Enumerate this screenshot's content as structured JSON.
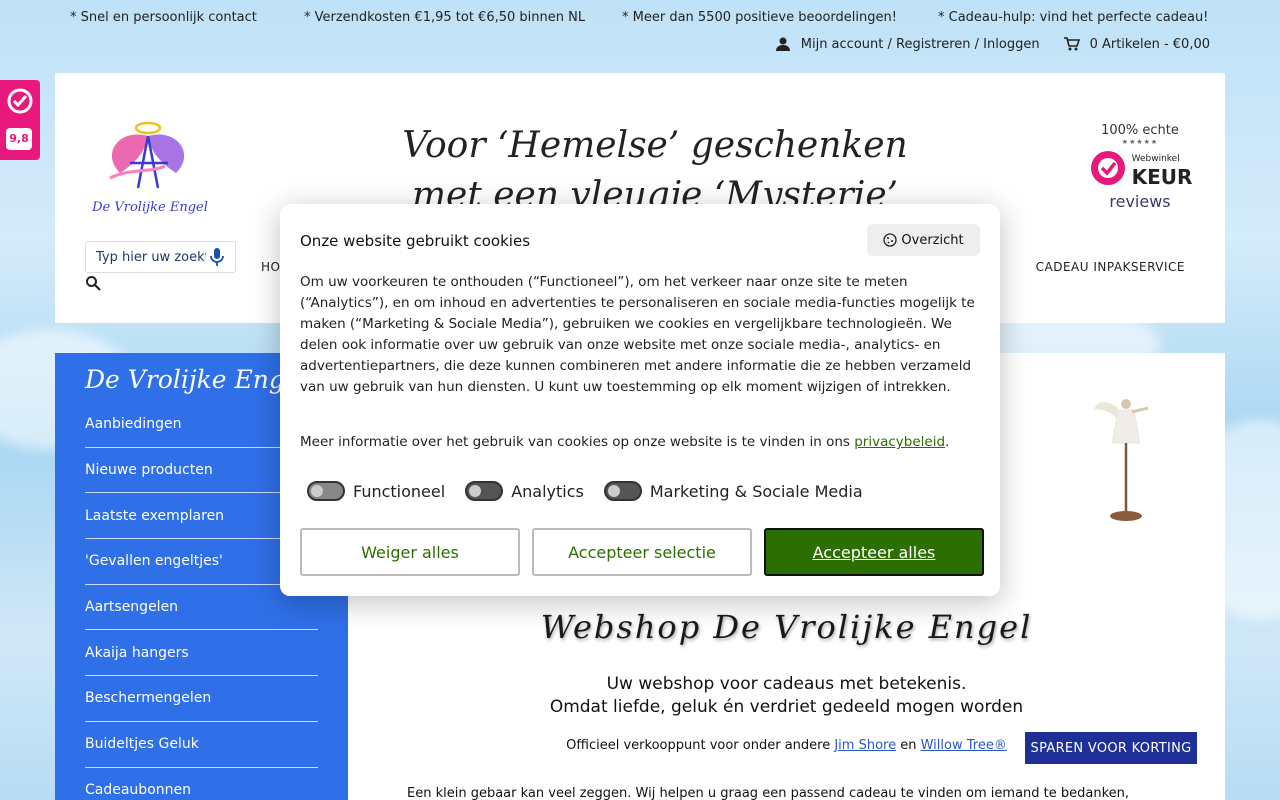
{
  "usp": [
    "* Snel en persoonlijk contact",
    "* Verzendkosten €1,95 tot €6,50 binnen NL",
    "* Meer dan 5500 positieve beoordelingen!",
    "* Cadeau-hulp: vind het perfecte cadeau!"
  ],
  "account": {
    "links": "Mijn account / Registreren / Inloggen",
    "cart": "0 Artikelen - €0,00"
  },
  "header": {
    "tagline_line1": "Voor ‘Hemelse’ geschenken",
    "tagline_line2": "met een vleugje ‘Mysterie’",
    "logo_text": "De Vrolijke Engel",
    "search_placeholder": "Typ hier uw zoekterm",
    "nav_home": "HO",
    "nav_wrap": "CADEAU INPAKSERVICE",
    "keur": {
      "echte": "100% echte",
      "stars": "★★★★★",
      "webwinkel": "Webwinkel",
      "keur": "KEUR",
      "reviews": "reviews"
    }
  },
  "kiyoh": {
    "score": "9,8"
  },
  "sidebar": {
    "title": "De Vrolijke Engel",
    "items": [
      "Aanbiedingen",
      "Nieuwe producten",
      "Laatste exemplaren",
      "'Gevallen engeltjes'",
      "Aartsengelen",
      "Akaija hangers",
      "Beschermengelen",
      "Buideltjes Geluk",
      "Cadeaubonnen"
    ]
  },
  "main": {
    "title": "Webshop De Vrolijke Engel",
    "subtitle_line1": "Uw webshop voor cadeaus met betekenis.",
    "subtitle_line2": "Omdat liefde, geluk én verdriet gedeeld mogen worden",
    "official_prefix": "Officieel verkooppunt voor onder andere ",
    "jim_shore": "Jim Shore",
    "official_en": " en ",
    "willow_tree": "Willow Tree®",
    "body": "Een klein gebaar kan veel zeggen. Wij helpen u graag een passend cadeau te vinden om iemand te bedanken,"
  },
  "cookie": {
    "title": "Onze website gebruikt cookies",
    "overview": "Overzicht",
    "description": "Om uw voorkeuren te onthouden (“Functioneel”), om het verkeer naar onze site te meten (“Analytics”), en om inhoud en advertenties te personaliseren en sociale media-functies mogelijk te maken (“Marketing & Sociale Media”), gebruiken we cookies en vergelijkbare technologieën. We delen ook informatie over uw gebruik van onze website met onze sociale media-, analytics- en advertentiepartners, die deze kunnen combineren met andere informatie die ze hebben verzameld van uw gebruik van hun diensten. U kunt uw toestemming op elk moment wijzigen of intrekken.",
    "more_prefix": "Meer informatie over het gebruik van cookies op onze website is te vinden in ons ",
    "privacy_link": "privacybeleid",
    "more_suffix": ".",
    "toggles": [
      "Functioneel",
      "Analytics",
      "Marketing & Sociale Media"
    ],
    "btn_reject": "Weiger alles",
    "btn_accept_selection": "Accepteer selectie",
    "btn_accept_all": "Accepteer alles"
  },
  "save_button": "SPAREN VOOR KORTING",
  "colors": {
    "sidebar_bg": "#2f6fe8",
    "accept_green": "#2c6e00",
    "kiyoh_pink": "#e8187d",
    "save_btn_bg": "#1e2f9a"
  }
}
